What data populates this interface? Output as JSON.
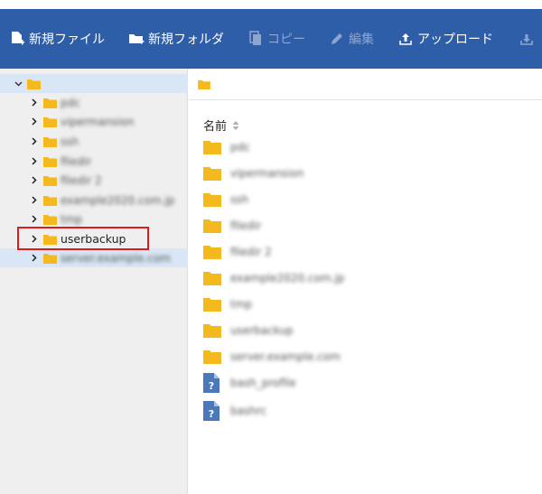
{
  "toolbar": {
    "new_file": "新規ファイル",
    "new_folder": "新規フォルダ",
    "copy": "コピー",
    "edit": "編集",
    "upload": "アップロード"
  },
  "tree": {
    "items": [
      {
        "label": "pdc",
        "blurred": true
      },
      {
        "label": "vipermansion",
        "blurred": true
      },
      {
        "label": "ssh",
        "blurred": true
      },
      {
        "label": "filedir",
        "blurred": true
      },
      {
        "label": "filedir 2",
        "blurred": true
      },
      {
        "label": "example2020.com.jp",
        "blurred": true
      },
      {
        "label": "tmp",
        "blurred": true
      },
      {
        "label": "userbackup",
        "blurred": false
      },
      {
        "label": "server.example.com",
        "blurred": true
      }
    ]
  },
  "list": {
    "header": "名前",
    "items": [
      {
        "label": "pdc",
        "type": "folder"
      },
      {
        "label": "vipermansion",
        "type": "folder"
      },
      {
        "label": "ssh",
        "type": "folder"
      },
      {
        "label": "filedir",
        "type": "folder"
      },
      {
        "label": "filedir 2",
        "type": "folder"
      },
      {
        "label": "example2020.com.jp",
        "type": "folder"
      },
      {
        "label": "tmp",
        "type": "folder"
      },
      {
        "label": "userbackup",
        "type": "folder"
      },
      {
        "label": "server.example.com",
        "type": "folder"
      },
      {
        "label": "bash_profile",
        "type": "file"
      },
      {
        "label": "bashrc",
        "type": "file"
      }
    ]
  },
  "colors": {
    "toolbar_bg": "#2f5ea8",
    "folder": "#f5b920",
    "highlight": "#e11b1b",
    "selected_row": "#d8e6f6"
  }
}
